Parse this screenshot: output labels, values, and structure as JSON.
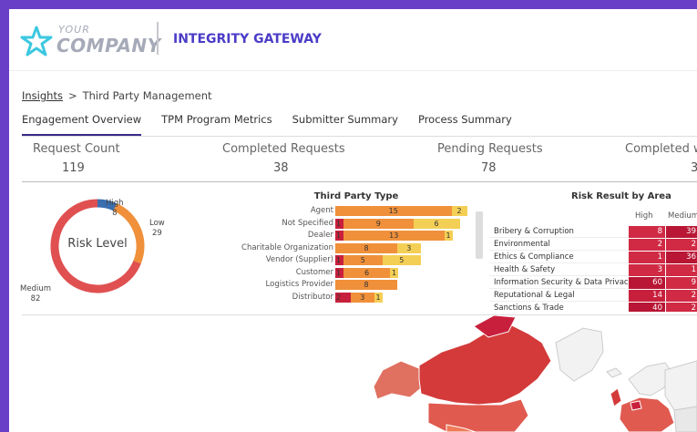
{
  "header": {
    "logo_your": "YOUR",
    "logo_company": "COMPANY",
    "app_title": "INTEGRITY GATEWAY"
  },
  "breadcrumb": {
    "link": "Insights",
    "separator": ">",
    "current": "Third Party Management"
  },
  "tabs": [
    {
      "label": "Engagement Overview",
      "active": true
    },
    {
      "label": "TPM Program Metrics",
      "active": false
    },
    {
      "label": "Submitter Summary",
      "active": false
    },
    {
      "label": "Process Summary",
      "active": false
    }
  ],
  "kpis": [
    {
      "label": "Request Count",
      "value": "119"
    },
    {
      "label": "Completed Requests",
      "value": "38"
    },
    {
      "label": "Pending Requests",
      "value": "78"
    },
    {
      "label": "Completed w",
      "value": "3"
    }
  ],
  "risk_level": {
    "center_label": "Risk Level",
    "high_label": "High",
    "high_value": "8",
    "low_label": "Low",
    "low_value": "29",
    "medium_label": "Medium",
    "medium_value": "82"
  },
  "third_party_type": {
    "title": "Third Party Type",
    "rows": [
      {
        "category": "Agent",
        "high": "",
        "medium": "15",
        "low": "2"
      },
      {
        "category": "Not Specified",
        "high": "1",
        "medium": "9",
        "low": "6"
      },
      {
        "category": "Dealer",
        "high": "1",
        "medium": "13",
        "low": "1"
      },
      {
        "category": "Charitable Organization",
        "high": "",
        "medium": "8",
        "low": "3"
      },
      {
        "category": "Vendor (Supplier)",
        "high": "1",
        "medium": "5",
        "low": "5"
      },
      {
        "category": "Customer",
        "high": "1",
        "medium": "6",
        "low": "1"
      },
      {
        "category": "Logistics Provider",
        "high": "",
        "medium": "8",
        "low": ""
      },
      {
        "category": "Distributor",
        "high": "2",
        "medium": "3",
        "low": "1"
      }
    ]
  },
  "risk_by_area": {
    "title": "Risk Result by Area",
    "col_high": "High",
    "col_medium": "Medium",
    "rows": [
      {
        "area": "Bribery & Corruption",
        "high": "8",
        "medium": "39"
      },
      {
        "area": "Environmental",
        "high": "2",
        "medium": "2"
      },
      {
        "area": "Ethics & Compliance",
        "high": "1",
        "medium": "36"
      },
      {
        "area": "Health & Safety",
        "high": "3",
        "medium": "1"
      },
      {
        "area": "Information Security & Data Privacy",
        "high": "60",
        "medium": "9"
      },
      {
        "area": "Reputational & Legal",
        "high": "14",
        "medium": "2"
      },
      {
        "area": "Sanctions & Trade",
        "high": "40",
        "medium": "2"
      }
    ]
  },
  "colors": {
    "brand": "#4b3cc7",
    "high": "#c8203c",
    "medium": "#f0903a",
    "low": "#f4cf55",
    "donut_high": "#3a6fb0",
    "donut_low": "#f0903a",
    "donut_medium": "#e05050"
  }
}
